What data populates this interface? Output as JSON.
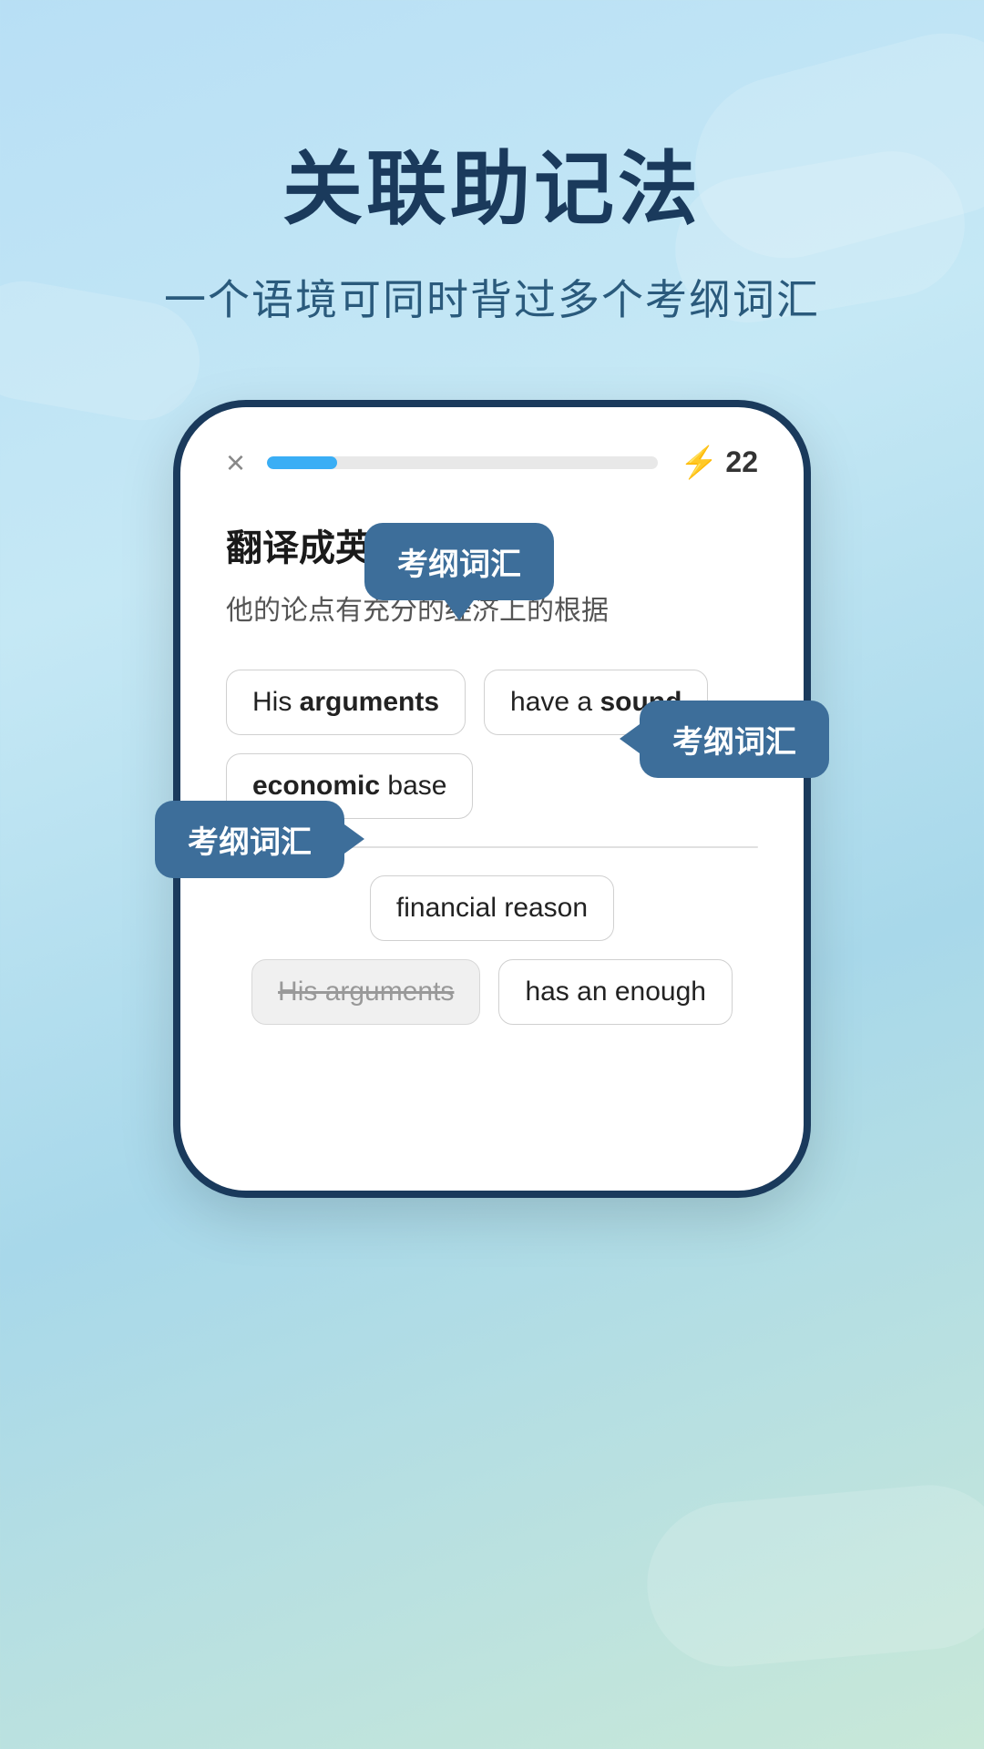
{
  "background": {
    "gradient_start": "#b8dff5",
    "gradient_end": "#c8e8d8"
  },
  "header": {
    "main_title": "关联助记法",
    "subtitle": "一个语境可同时背过多个考纲词汇"
  },
  "phone": {
    "top_bar": {
      "close_symbol": "×",
      "score": "22",
      "progress_percent": 18
    },
    "question_label": "翻译成英文",
    "question_text": "他的论点有充分的经济上的根据",
    "answer_options_row1": [
      {
        "text": "His ",
        "bold": "arguments",
        "suffix": ""
      },
      {
        "text": "",
        "bold": "",
        "suffix": "have a sound"
      }
    ],
    "answer_options_row2": [
      {
        "text": "",
        "bold": "economic",
        "suffix": " base"
      }
    ],
    "bottom_options_row1": [
      {
        "text": "financial reason",
        "style": "normal"
      }
    ],
    "bottom_options_row2": [
      {
        "text": "His arguments",
        "style": "gray"
      },
      {
        "text": "has an enough",
        "style": "normal"
      }
    ],
    "tooltips": [
      {
        "id": 1,
        "label": "考纲词汇"
      },
      {
        "id": 2,
        "label": "考纲词汇"
      },
      {
        "id": 3,
        "label": "考纲词汇"
      }
    ]
  }
}
